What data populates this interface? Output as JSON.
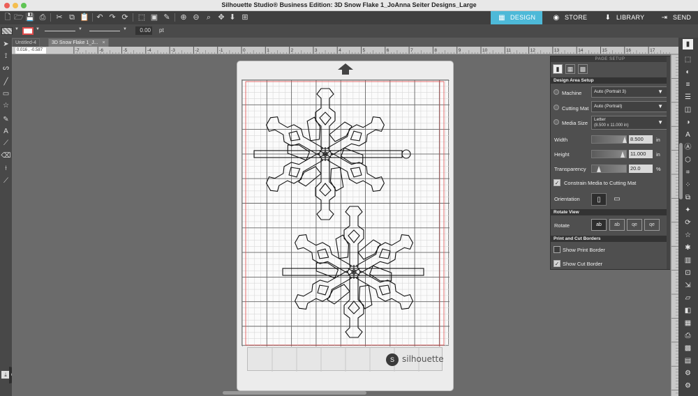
{
  "window": {
    "title": "Silhouette Studio® Business Edition: 3D Snow Flake 1_JoAnna Seiter Designs_Large"
  },
  "nav_tabs": [
    {
      "label": "DESIGN",
      "icon": "design-icon"
    },
    {
      "label": "STORE",
      "icon": "store-icon"
    },
    {
      "label": "LIBRARY",
      "icon": "library-icon"
    },
    {
      "label": "SEND",
      "icon": "send-icon"
    }
  ],
  "line_options": {
    "line_width": "0.00",
    "unit": "pt"
  },
  "doc_tabs": [
    {
      "label": "Untitled-4"
    },
    {
      "label": "3D Snow Flake 1_J...",
      "close": "×"
    }
  ],
  "ruler": {
    "coordinates": "0.016 , -0.587",
    "ticks": [
      "-7",
      "-6",
      "-5",
      "-4",
      "-3",
      "-2",
      "-1",
      "0",
      "1",
      "2",
      "3",
      "4",
      "5",
      "6",
      "7",
      "8",
      "9",
      "10",
      "11",
      "12",
      "13",
      "14",
      "15",
      "16",
      "17"
    ]
  },
  "mat": {
    "brand": "silhouette",
    "brand_mark": "S"
  },
  "page_setup": {
    "title": "PAGE SETUP",
    "design_area_section": "Design Area Setup",
    "machine_label": "Machine",
    "machine_value": "Auto (Portrait 3)",
    "cutting_mat_label": "Cutting Mat",
    "cutting_mat_value": "Auto (Portrait)",
    "media_size_label": "Media Size",
    "media_size_value": "Letter",
    "media_size_sub": "(8.500 x 11.000 in)",
    "width_label": "Width",
    "width_value": "8.500",
    "width_unit": "in",
    "height_label": "Height",
    "height_value": "11.000",
    "height_unit": "in",
    "transparency_label": "Transparency",
    "transparency_value": "20.0",
    "transparency_unit": "%",
    "constrain_label": "Constrain Media to Cutting Mat",
    "orientation_label": "Orientation",
    "rotate_section": "Rotate View",
    "rotate_label": "Rotate",
    "rotate_options": [
      "ab",
      "ab",
      "qe",
      "qe"
    ],
    "borders_section": "Print and Cut Borders",
    "show_print_border_label": "Show Print Border",
    "show_cut_border_label": "Show Cut Border",
    "constrain_checked": true,
    "show_print_border_checked": false,
    "show_cut_border_checked": true
  },
  "colors": {
    "accent": "#4db9d8",
    "canvas": "#6b6b6b",
    "panel": "#4f4f4f",
    "cut_border": "#e04a4a"
  }
}
